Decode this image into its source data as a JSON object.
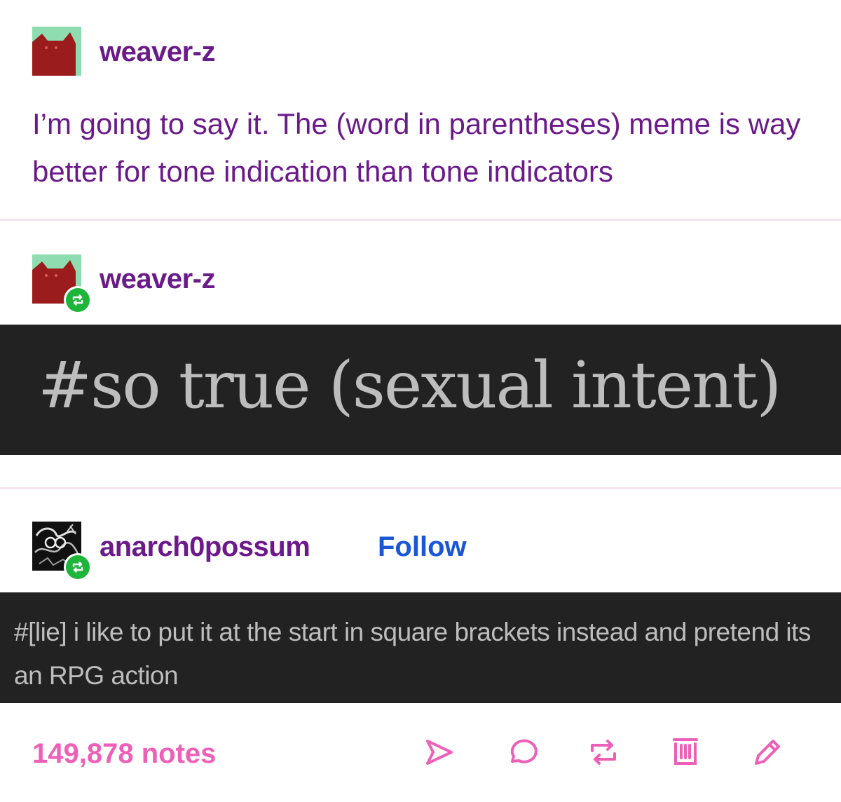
{
  "posts": [
    {
      "username": "weaver-z",
      "body": "I’m going to say it. The (word in parentheses) meme is way better for tone indication than tone indicators"
    },
    {
      "username": "weaver-z",
      "tags": "#so true (sexual intent)"
    },
    {
      "username": "anarch0possum",
      "follow_label": "Follow",
      "tags": "#[lie] i like to put it at the start in square brackets instead and pretend its an RPG action"
    }
  ],
  "footer": {
    "notes": "149,878 notes",
    "actions": [
      "share-icon",
      "reply-icon",
      "reblog-icon",
      "queue-icon",
      "edit-icon"
    ]
  },
  "colors": {
    "username": "#6b1a8a",
    "follow": "#1a56d6",
    "accent_pink": "#ee5fb8",
    "reblog_green": "#1db53a",
    "tag_bar": "#222222"
  }
}
